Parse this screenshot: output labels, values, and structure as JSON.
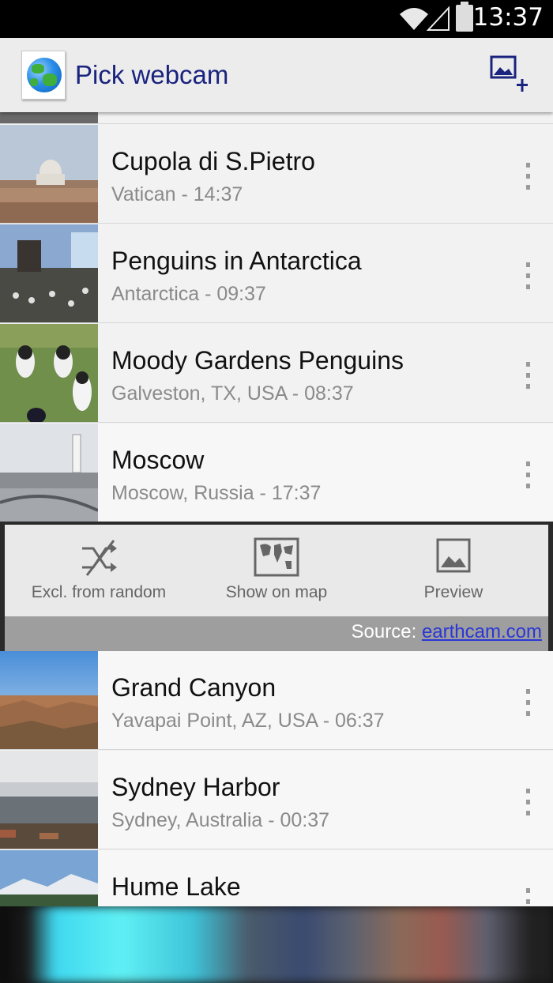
{
  "status_bar": {
    "time": "13:37"
  },
  "action_bar": {
    "title": "Pick webcam",
    "add_icon": "add-image-icon",
    "app_icon": "globe-icon"
  },
  "webcams_top": [
    {
      "name": "Cupola di S.Pietro",
      "subtitle": "Vatican - 14:37"
    },
    {
      "name": "Penguins in Antarctica",
      "subtitle": "Antarctica - 09:37"
    },
    {
      "name": "Moody Gardens Penguins",
      "subtitle": "Galveston, TX, USA - 08:37"
    },
    {
      "name": "Moscow",
      "subtitle": "Moscow, Russia - 17:37"
    }
  ],
  "expanded_actions": {
    "exclude_label": "Excl. from random",
    "map_label": "Show on map",
    "preview_label": "Preview",
    "source_prefix": "Source: ",
    "source_link": "earthcam.com"
  },
  "webcams_bottom": [
    {
      "name": "Grand Canyon",
      "subtitle": "Yavapai Point, AZ, USA - 06:37"
    },
    {
      "name": "Sydney Harbor",
      "subtitle": "Sydney, Australia - 00:37"
    },
    {
      "name": "Hume Lake",
      "subtitle": ""
    }
  ],
  "colors": {
    "accent": "#1a237e",
    "link": "#2a37d6"
  }
}
